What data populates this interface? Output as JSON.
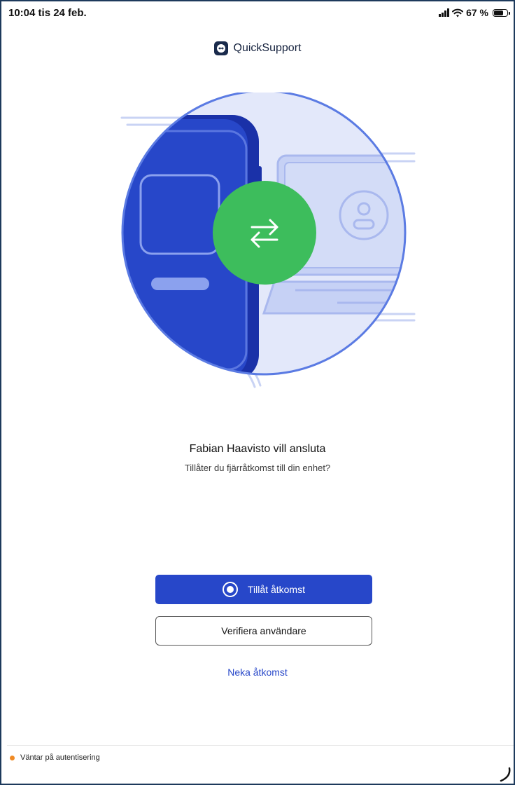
{
  "status_bar": {
    "time": "10:04  tis 24 feb.",
    "battery_text": "67 %",
    "icons": [
      "signal-icon",
      "wifi-icon",
      "battery-icon"
    ]
  },
  "header": {
    "app_name": "QuickSupport",
    "logo_icon": "teamviewer-logo-icon"
  },
  "illustration": {
    "center_icon": "swap-arrows-icon",
    "colors": {
      "phone_blue": "#2747c9",
      "circle_bg": "#e3e8fa",
      "circle_border": "#5b7be3",
      "green": "#3dbd5c",
      "light_blue": "#b9c6f2"
    }
  },
  "prompt": {
    "title": "Fabian Haavisto vill ansluta",
    "subtitle": "Tillåter du fjärråtkomst till din enhet?"
  },
  "actions": {
    "allow_label": "Tillåt åtkomst",
    "verify_label": "Verifiera användare",
    "deny_label": "Neka åtkomst"
  },
  "footer": {
    "status_text": "Väntar på autentisering",
    "status_color": "#f08a24"
  },
  "colors": {
    "accent": "#2747c9",
    "frame_border": "#1d3a5c"
  }
}
